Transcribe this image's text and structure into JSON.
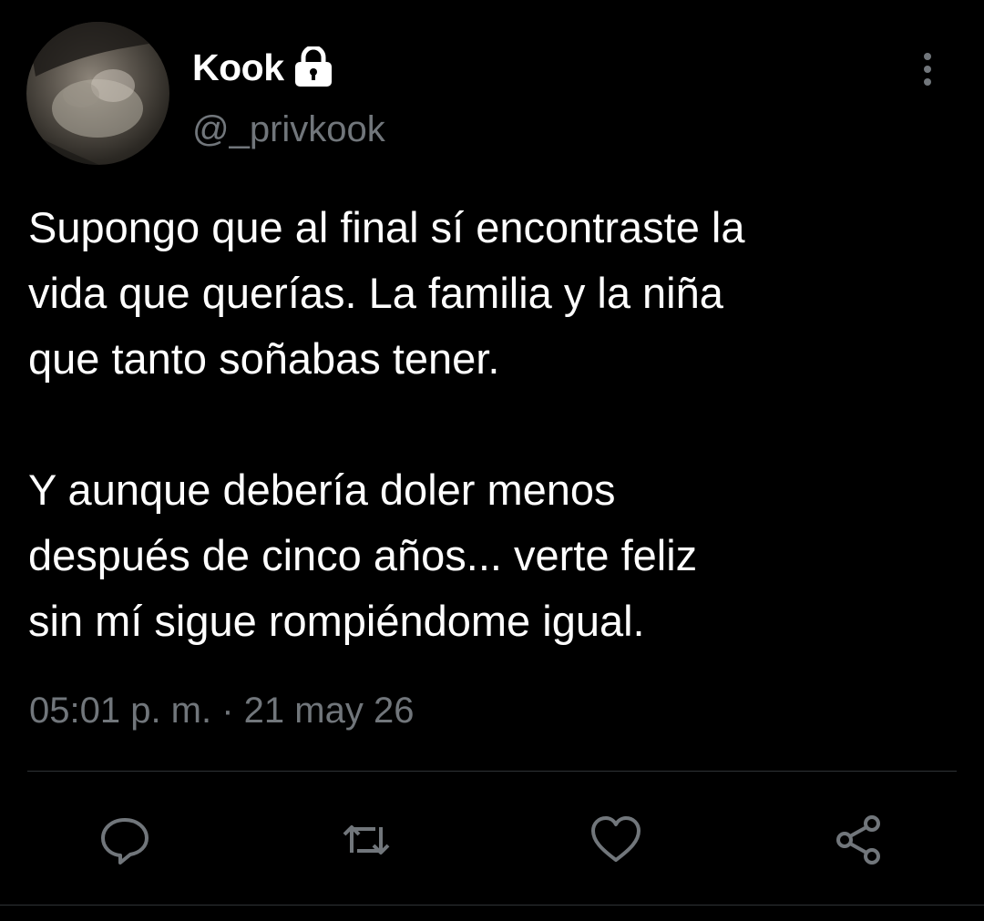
{
  "tweet": {
    "author": {
      "display_name": "Kook",
      "handle": "@_privkook",
      "avatar_icon": "avatar-photo",
      "protected_icon": "lock-icon"
    },
    "text": "Supongo que al final sí encontraste la\nvida que querías. La familia y la niña\nque tanto soñabas tener.\n\nY aunque debería doler menos\ndespués de cinco años... verte feliz\nsin mí sigue rompiéndome igual.",
    "timestamp": {
      "time": "05:01 p. m.",
      "separator": " · ",
      "date": "21 may 26"
    },
    "actions": [
      {
        "name": "reply",
        "icon": "reply-icon"
      },
      {
        "name": "retweet",
        "icon": "retweet-icon"
      },
      {
        "name": "like",
        "icon": "heart-icon"
      },
      {
        "name": "share",
        "icon": "share-icon"
      }
    ],
    "menu_icon": "more-vertical-icon"
  },
  "colors": {
    "background": "#000000",
    "primary_text": "#ffffff",
    "secondary_text": "#71767b",
    "divider": "#2f3336",
    "icon": "#71767b"
  }
}
